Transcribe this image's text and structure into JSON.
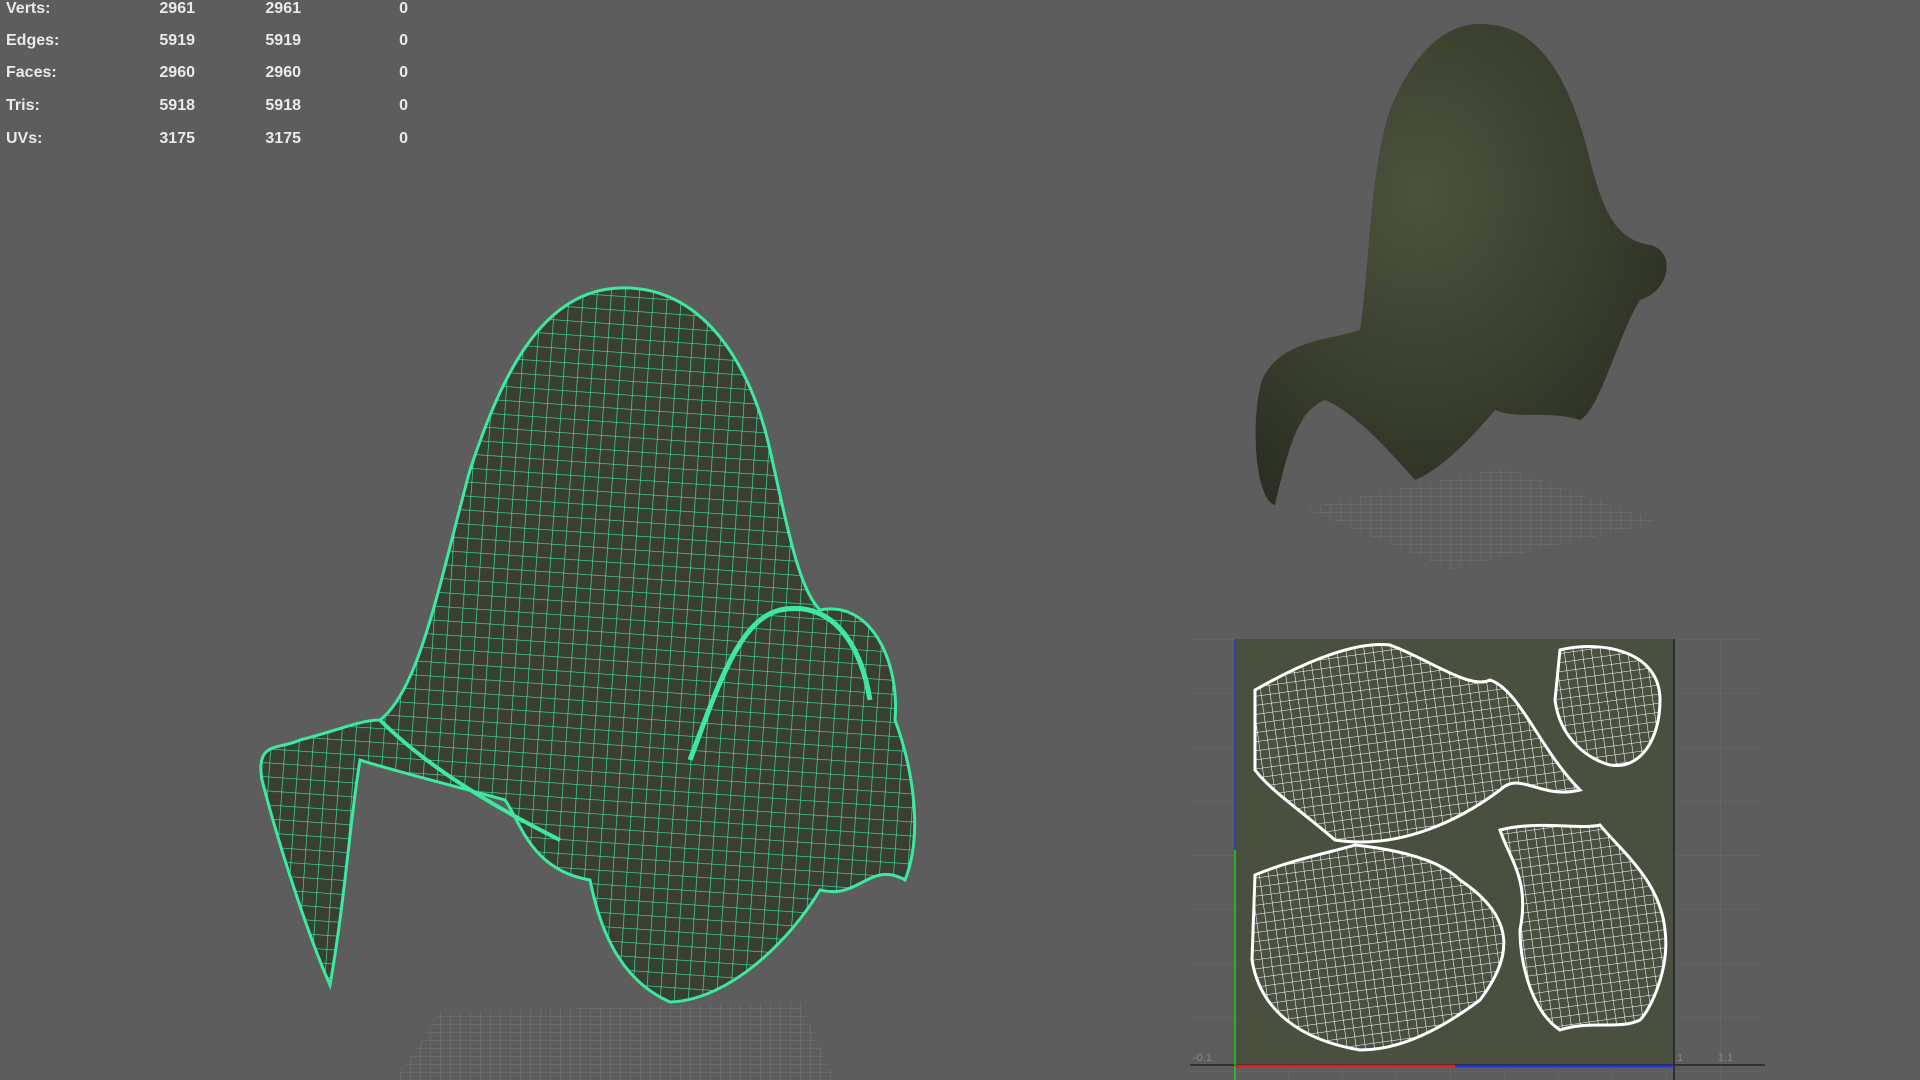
{
  "stats": [
    {
      "label": "Verts:",
      "a": "2961",
      "b": "2961",
      "c": "0"
    },
    {
      "label": "Edges:",
      "a": "5919",
      "b": "5919",
      "c": "0"
    },
    {
      "label": "Faces:",
      "a": "2960",
      "b": "2960",
      "c": "0"
    },
    {
      "label": "Tris:",
      "a": "5918",
      "b": "5918",
      "c": "0"
    },
    {
      "label": "UVs:",
      "a": "3175",
      "b": "3175",
      "c": "0"
    }
  ],
  "uv_editor": {
    "tick_left": "-0.1",
    "tick_one": "1",
    "tick_right": "1.1"
  },
  "colors": {
    "background": "#5d5d5d",
    "wireframe": "#3ee8a0",
    "cloth": "#3d4230",
    "uv_bg": "#4a5040",
    "axis_u": "#e02020",
    "axis_v": "#2030d0",
    "axis_green": "#20d020"
  }
}
